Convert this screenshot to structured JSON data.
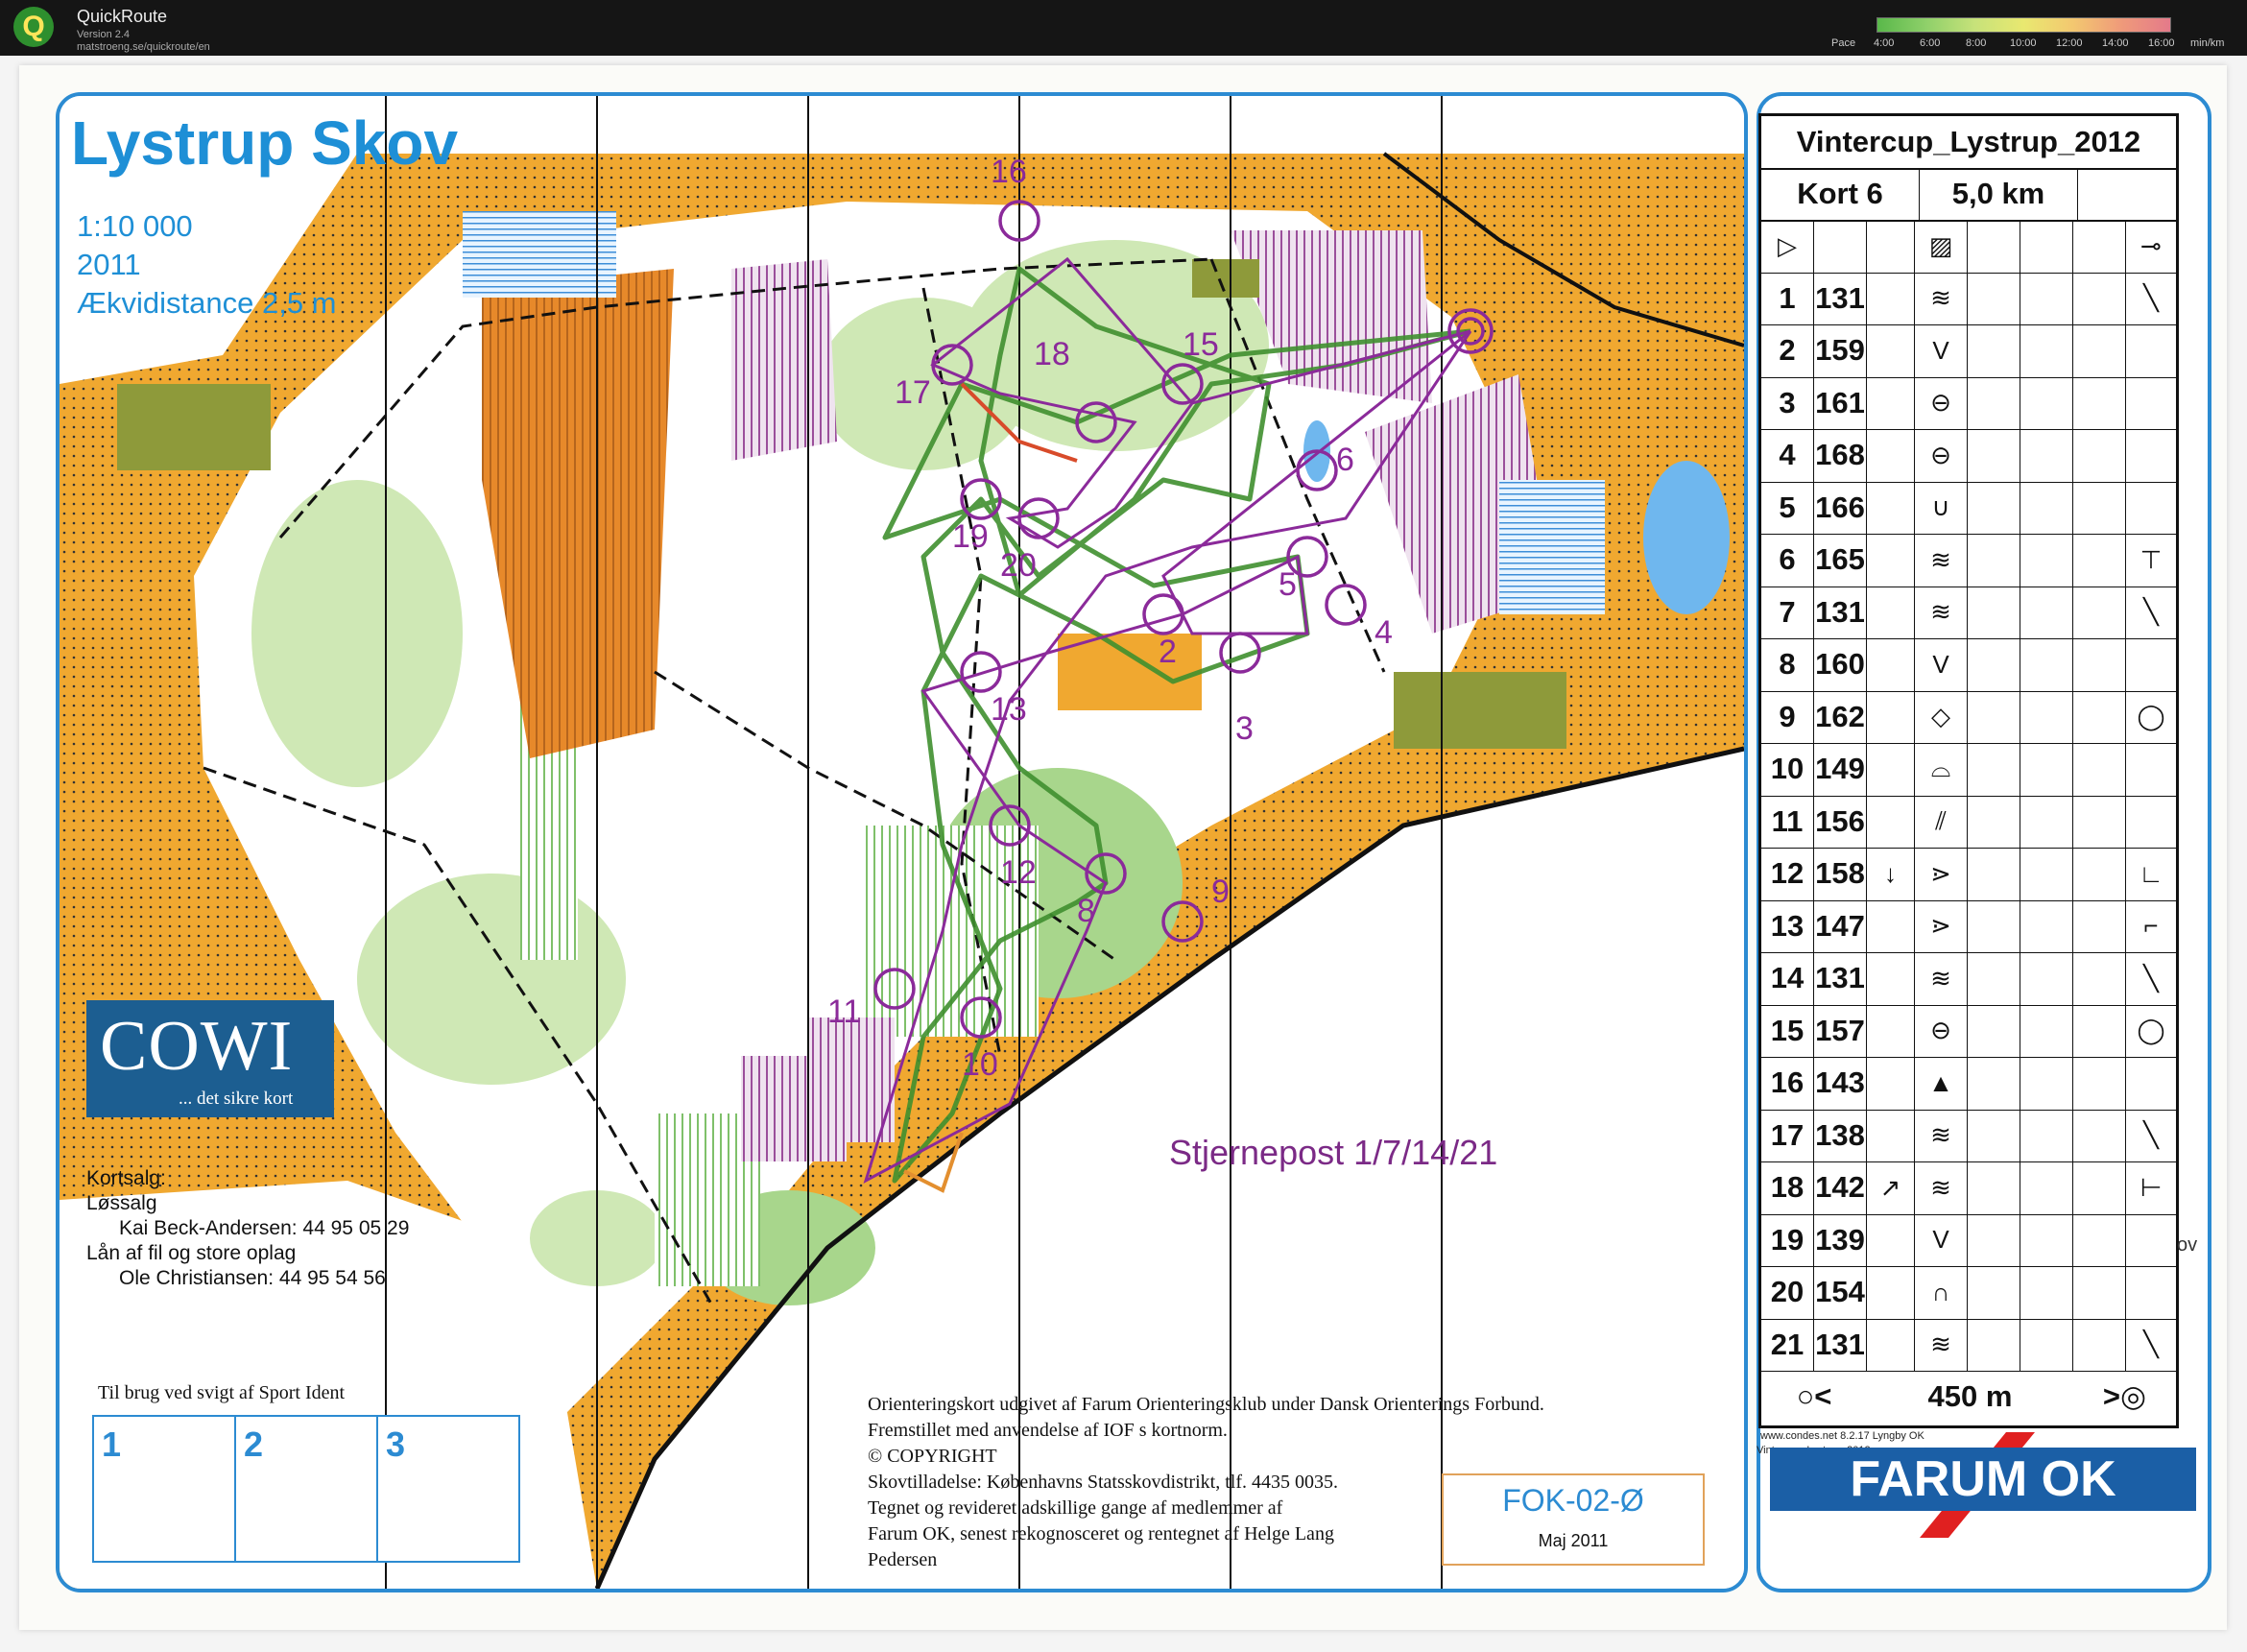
{
  "app": {
    "logo_glyph": "Q",
    "name": "QuickRoute",
    "version": "Version 2.4",
    "url": "matstroeng.se/quickroute/en",
    "pace_label": "Pace",
    "pace_ticks": [
      "4:00",
      "6:00",
      "8:00",
      "10:00",
      "12:00",
      "14:00",
      "16:00"
    ],
    "pace_unit": "min/km"
  },
  "map": {
    "title": "Lystrup Skov",
    "scale": "1:10 000",
    "year": "2011",
    "contour": "Ækvidistance 2,5 m",
    "cowi": {
      "word": "COWI",
      "tagline": "... det sikre kort"
    },
    "sales": {
      "heading": "Kortsalg:",
      "sub1": "Løssalg",
      "person1": "Kai Beck-Andersen: 44 95 05 29",
      "sub2": "Lån af fil og store oplag",
      "person2": "Ole Christiansen: 44 95 54 56"
    },
    "si_caption": "Til brug ved svigt af Sport Ident",
    "si_boxes": [
      "1",
      "2",
      "3"
    ],
    "publisher_lines": [
      "Orienteringskort udgivet af Farum Orienteringsklub under Dansk Orienterings Forbund.",
      "Fremstillet med anvendelse af IOF s kortnorm.",
      "© COPYRIGHT",
      "Skovtilladelse: Københavns Statsskovdistrikt, tlf. 4435 0035.",
      "Tegnet og revideret adskillige gange af medlemmer af",
      "Farum OK, senest rekognosceret og rentegnet af Helge Lang",
      "Pedersen"
    ],
    "map_code": "FOK-02-Ø",
    "map_date": "Maj 2011",
    "star_note": "Stjernepost   1/7/14/21",
    "controls": [
      "2",
      "3",
      "4",
      "5",
      "6",
      "8",
      "9",
      "10",
      "11",
      "12",
      "13",
      "15",
      "16",
      "17",
      "18",
      "19",
      "20"
    ]
  },
  "description": {
    "event": "Vintercup_Lystrup_2012",
    "course": "Kort 6",
    "length": "5,0 km",
    "rows": [
      {
        "n": "1",
        "code": "131",
        "dir": "",
        "feat": "≋",
        "pos": "╲"
      },
      {
        "n": "2",
        "code": "159",
        "dir": "",
        "feat": "V",
        "pos": ""
      },
      {
        "n": "3",
        "code": "161",
        "dir": "",
        "feat": "⊖",
        "pos": ""
      },
      {
        "n": "4",
        "code": "168",
        "dir": "",
        "feat": "⊖",
        "pos": ""
      },
      {
        "n": "5",
        "code": "166",
        "dir": "",
        "feat": "∪",
        "pos": ""
      },
      {
        "n": "6",
        "code": "165",
        "dir": "",
        "feat": "≋",
        "pos": "⊤"
      },
      {
        "n": "7",
        "code": "131",
        "dir": "",
        "feat": "≋",
        "pos": "╲"
      },
      {
        "n": "8",
        "code": "160",
        "dir": "",
        "feat": "V",
        "pos": ""
      },
      {
        "n": "9",
        "code": "162",
        "dir": "",
        "feat": "◇",
        "pos": "◯"
      },
      {
        "n": "10",
        "code": "149",
        "dir": "",
        "feat": "⌓",
        "pos": ""
      },
      {
        "n": "11",
        "code": "156",
        "dir": "",
        "feat": "⫽",
        "pos": ""
      },
      {
        "n": "12",
        "code": "158",
        "dir": "↓",
        "feat": "⋗",
        "pos": "∟"
      },
      {
        "n": "13",
        "code": "147",
        "dir": "",
        "feat": "⋗",
        "pos": "⌐"
      },
      {
        "n": "14",
        "code": "131",
        "dir": "",
        "feat": "≋",
        "pos": "╲"
      },
      {
        "n": "15",
        "code": "157",
        "dir": "",
        "feat": "⊖",
        "pos": "◯"
      },
      {
        "n": "16",
        "code": "143",
        "dir": "",
        "feat": "▲",
        "pos": ""
      },
      {
        "n": "17",
        "code": "138",
        "dir": "",
        "feat": "≋",
        "pos": "╲"
      },
      {
        "n": "18",
        "code": "142",
        "dir": "↗",
        "feat": "≋",
        "pos": "⊢"
      },
      {
        "n": "19",
        "code": "139",
        "dir": "",
        "feat": "V",
        "pos": ""
      },
      {
        "n": "20",
        "code": "154",
        "dir": "",
        "feat": "∩",
        "pos": ""
      },
      {
        "n": "21",
        "code": "131",
        "dir": "",
        "feat": "≋",
        "pos": "╲"
      }
    ],
    "start_symbol": "▷",
    "start_feature": "▨",
    "start_pos": "⊸",
    "finish_left": "○<",
    "finish_distance": "450 m",
    "finish_right": ">◎",
    "condes": "www.condes.net 8.2.17 Lyngby OK",
    "condes2": "Vintercup_Lystrup_2012",
    "club": "FARUM OK",
    "side_fragment": "ov"
  },
  "colors": {
    "orange": "#f0a830",
    "forest_green": "#a8d68c",
    "light_green": "#cfe8b5",
    "olive": "#8e9a3a",
    "purple": "#8b2a9a",
    "blue": "#2c8bd2",
    "route": "#3f8f2f"
  }
}
